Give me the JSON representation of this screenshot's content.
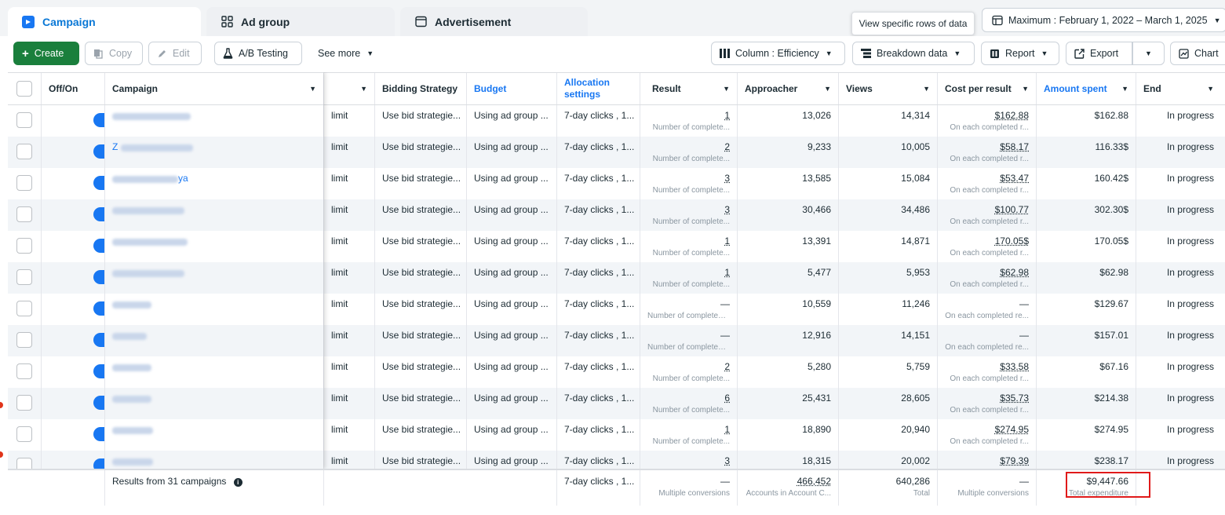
{
  "tabs": [
    {
      "label": "Campaign",
      "icon": "folder-icon",
      "active": true
    },
    {
      "label": "Ad group",
      "icon": "grid-icon",
      "active": false
    },
    {
      "label": "Advertisement",
      "icon": "ad-window-icon",
      "active": false
    }
  ],
  "tooltip": "View specific rows of data",
  "date_range": "Maximum : February 1, 2022 – March 1, 2025",
  "toolbar": {
    "create": "Create",
    "copy": "Copy",
    "edit": "Edit",
    "ab_testing": "A/B Testing",
    "see_more": "See more",
    "column": "Column : Efficiency",
    "breakdown": "Breakdown data",
    "report": "Report",
    "export": "Export",
    "chart": "Chart"
  },
  "columns": {
    "offon": "Off/On",
    "campaign": "Campaign",
    "bidding": "Bidding Strategy",
    "budget": "Budget",
    "allocation": "Allocation settings",
    "result": "Result",
    "approacher": "Approacher",
    "views": "Views",
    "cost": "Cost per result",
    "amount": "Amount spent",
    "end": "End"
  },
  "rows": [
    {
      "name_tail": "",
      "limit": "limit",
      "bidding": "Use bid strategie...",
      "budget": "Using ad group ...",
      "allocation": "7-day clicks , 1...",
      "result": "1",
      "result_sub": "Number of complete...",
      "approacher": "13,026",
      "views": "14,314",
      "cost": "$162.88",
      "cost_sub": "On each completed r...",
      "amount": "$162.88",
      "end": "In progress"
    },
    {
      "name_tail": "Z",
      "limit": "limit",
      "bidding": "Use bid strategie...",
      "budget": "Using ad group ...",
      "allocation": "7-day clicks , 1...",
      "result": "2",
      "result_sub": "Number of complete...",
      "approacher": "9,233",
      "views": "10,005",
      "cost": "$58.17",
      "cost_sub": "On each completed r...",
      "amount": "116.33$",
      "end": "In progress"
    },
    {
      "name_tail": "ya",
      "limit": "limit",
      "bidding": "Use bid strategie...",
      "budget": "Using ad group ...",
      "allocation": "7-day clicks , 1...",
      "result": "3",
      "result_sub": "Number of complete...",
      "approacher": "13,585",
      "views": "15,084",
      "cost": "$53.47",
      "cost_sub": "On each completed r...",
      "amount": "160.42$",
      "end": "In progress"
    },
    {
      "name_tail": "",
      "limit": "limit",
      "bidding": "Use bid strategie...",
      "budget": "Using ad group ...",
      "allocation": "7-day clicks , 1...",
      "result": "3",
      "result_sub": "Number of complete...",
      "approacher": "30,466",
      "views": "34,486",
      "cost": "$100.77",
      "cost_sub": "On each completed r...",
      "amount": "302.30$",
      "end": "In progress"
    },
    {
      "name_tail": "",
      "limit": "limit",
      "bidding": "Use bid strategie...",
      "budget": "Using ad group ...",
      "allocation": "7-day clicks , 1...",
      "result": "1",
      "result_sub": "Number of complete...",
      "approacher": "13,391",
      "views": "14,871",
      "cost": "170.05$",
      "cost_sub": "On each completed r...",
      "amount": "170.05$",
      "end": "In progress"
    },
    {
      "name_tail": "",
      "limit": "limit",
      "bidding": "Use bid strategie...",
      "budget": "Using ad group ...",
      "allocation": "7-day clicks , 1...",
      "result": "1",
      "result_sub": "Number of complete...",
      "approacher": "5,477",
      "views": "5,953",
      "cost": "$62.98",
      "cost_sub": "On each completed r...",
      "amount": "$62.98",
      "end": "In progress"
    },
    {
      "name_tail": "",
      "limit": "limit",
      "bidding": "Use bid strategie...",
      "budget": "Using ad group ...",
      "allocation": "7-day clicks , 1...",
      "result": "—",
      "result_sub": "Number of completed ...",
      "approacher": "10,559",
      "views": "11,246",
      "cost": "—",
      "cost_sub": "On each completed re...",
      "amount": "$129.67",
      "end": "In progress"
    },
    {
      "name_tail": "",
      "limit": "limit",
      "bidding": "Use bid strategie...",
      "budget": "Using ad group ...",
      "allocation": "7-day clicks , 1...",
      "result": "—",
      "result_sub": "Number of completed ...",
      "approacher": "12,916",
      "views": "14,151",
      "cost": "—",
      "cost_sub": "On each completed re...",
      "amount": "$157.01",
      "end": "In progress"
    },
    {
      "name_tail": "",
      "limit": "limit",
      "bidding": "Use bid strategie...",
      "budget": "Using ad group ...",
      "allocation": "7-day clicks , 1...",
      "result": "2",
      "result_sub": "Number of complete...",
      "approacher": "5,280",
      "views": "5,759",
      "cost": "$33.58",
      "cost_sub": "On each completed r...",
      "amount": "$67.16",
      "end": "In progress"
    },
    {
      "name_tail": "",
      "limit": "limit",
      "bidding": "Use bid strategie...",
      "budget": "Using ad group ...",
      "allocation": "7-day clicks , 1...",
      "result": "6",
      "result_sub": "Number of complete...",
      "approacher": "25,431",
      "views": "28,605",
      "cost": "$35.73",
      "cost_sub": "On each completed r...",
      "amount": "$214.38",
      "end": "In progress"
    },
    {
      "name_tail": "",
      "limit": "limit",
      "bidding": "Use bid strategie...",
      "budget": "Using ad group ...",
      "allocation": "7-day clicks , 1...",
      "result": "1",
      "result_sub": "Number of complete...",
      "approacher": "18,890",
      "views": "20,940",
      "cost": "$274.95",
      "cost_sub": "On each completed r...",
      "amount": "$274.95",
      "end": "In progress"
    },
    {
      "name_tail": "",
      "limit": "limit",
      "bidding": "Use bid strategie...",
      "budget": "Using ad group ...",
      "allocation": "7-day clicks , 1...",
      "result": "3",
      "result_sub": "",
      "approacher": "18,315",
      "views": "20,002",
      "cost": "$79.39",
      "cost_sub": "",
      "amount": "$238.17",
      "end": "In progress"
    }
  ],
  "footer": {
    "label": "Results from 31 campaigns",
    "allocation": "7-day clicks , 1...",
    "result": "—",
    "result_sub": "Multiple conversions",
    "approacher": "466,452",
    "approacher_sub": "Accounts in Account C...",
    "views": "640,286",
    "views_sub": "Total",
    "cost": "—",
    "cost_sub": "Multiple conversions",
    "amount": "$9,447.66",
    "amount_sub": "Total expenditure"
  },
  "colors": {
    "accent": "#1877f2",
    "create": "#1a7f3c",
    "highlight": "#e01a1a"
  }
}
